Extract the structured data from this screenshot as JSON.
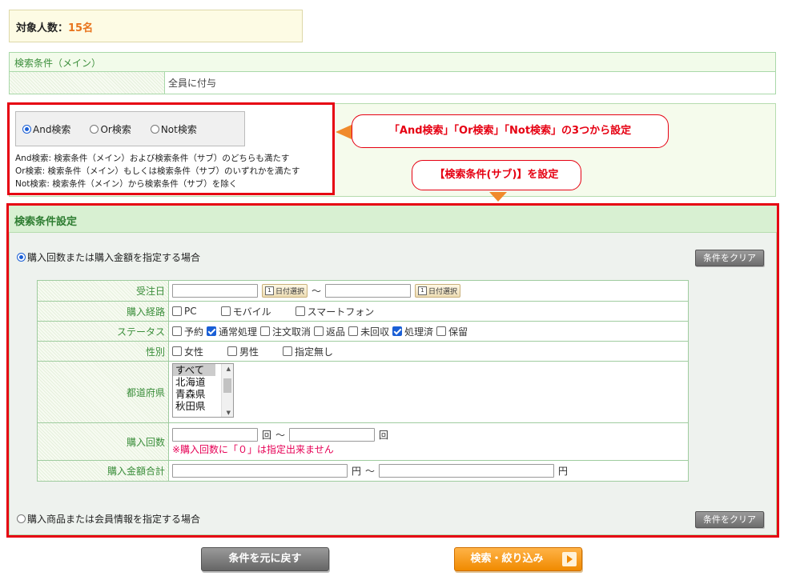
{
  "target": {
    "label": "対象人数：",
    "count": "15名"
  },
  "main_conditions": {
    "title": "検索条件（メイン）",
    "value": "全員に付与"
  },
  "logic": {
    "options": [
      {
        "label": "And検索",
        "selected": true
      },
      {
        "label": "Or検索",
        "selected": false
      },
      {
        "label": "Not検索",
        "selected": false
      }
    ],
    "descriptions": [
      "And検索: 検索条件（メイン）および検索条件（サブ）のどちらも満たす",
      "Or検索: 検索条件（メイン）もしくは検索条件（サブ）のいずれかを満たす",
      "Not検索: 検索条件（メイン）から検索条件（サブ）を除く"
    ]
  },
  "callouts": {
    "logic_note": "「And検索」「Or検索」「Not検索」の3つから設定",
    "sub_note": "【検索条件(サブ)】を設定"
  },
  "settings": {
    "title": "検索条件設定",
    "section1": {
      "label": "購入回数または購入金額を指定する場合",
      "selected": true,
      "clear": "条件をクリア"
    },
    "section2": {
      "label": "購入商品または会員情報を指定する場合",
      "selected": false,
      "clear": "条件をクリア"
    },
    "rows": {
      "order_date": {
        "label": "受注日",
        "date_btn": "日付選択",
        "tilde": "～"
      },
      "channel": {
        "label": "購入経路",
        "options": [
          {
            "label": "PC",
            "checked": false
          },
          {
            "label": "モバイル",
            "checked": false
          },
          {
            "label": "スマートフォン",
            "checked": false
          }
        ]
      },
      "status": {
        "label": "ステータス",
        "options": [
          {
            "label": "予約",
            "checked": false
          },
          {
            "label": "通常処理",
            "checked": true
          },
          {
            "label": "注文取消",
            "checked": false
          },
          {
            "label": "返品",
            "checked": false
          },
          {
            "label": "未回収",
            "checked": false
          },
          {
            "label": "処理済",
            "checked": true
          },
          {
            "label": "保留",
            "checked": false
          }
        ]
      },
      "gender": {
        "label": "性別",
        "options": [
          {
            "label": "女性",
            "checked": false
          },
          {
            "label": "男性",
            "checked": false
          },
          {
            "label": "指定無し",
            "checked": false
          }
        ]
      },
      "prefecture": {
        "label": "都道府県",
        "options": [
          "すべて",
          "北海道",
          "青森県",
          "秋田県"
        ]
      },
      "purchase_count": {
        "label": "購入回数",
        "unit": "回",
        "tilde": "～",
        "note": "※購入回数に「０」は指定出来ません"
      },
      "purchase_total": {
        "label": "購入金額合計",
        "unit": "円",
        "tilde": "～"
      }
    }
  },
  "buttons": {
    "reset": "条件を元に戻す",
    "search": "検索・絞り込み"
  },
  "colors": {
    "accent_red": "#e60012",
    "orange": "#f08a2c",
    "green_text": "#3b8e3b"
  }
}
